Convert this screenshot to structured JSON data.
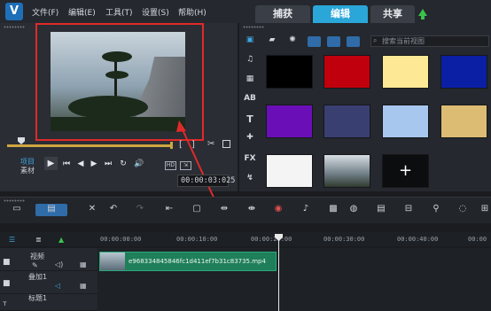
{
  "menu": {
    "logo": "V",
    "items": [
      "文件(F)",
      "编辑(E)",
      "工具(T)",
      "设置(S)",
      "帮助(H)"
    ]
  },
  "tabs": [
    {
      "label": "捕获",
      "active": false
    },
    {
      "label": "编辑",
      "active": true
    },
    {
      "label": "共享",
      "active": false
    }
  ],
  "player": {
    "mode_project": "项目",
    "mode_clip": "素材",
    "timecode": "00:00:03:025",
    "mark_in": "[",
    "mark_out": "]"
  },
  "library": {
    "search_placeholder": "搜索当前视图",
    "sidebar_labels": [
      "FX"
    ],
    "swatch_colors": [
      "#000000",
      "#c0000d",
      "#fde995",
      "#0b1fa5",
      "#6a0fb8",
      "#3a3f72",
      "#a8c7ef",
      "#dcbb73"
    ],
    "add_label": "+"
  },
  "timeline": {
    "ruler": [
      "00:00:00:00",
      "00:00:10:00",
      "00:00:20:00",
      "00:00:30:00",
      "00:00:40:00",
      "00:00"
    ],
    "tracks": [
      "视频",
      "叠加1",
      "标题1"
    ],
    "clip_name": "e968334845846fc1d411ef7b31c83735.mp4"
  },
  "colors": {
    "accent": "#2aa6d8",
    "highlight": "#e02a2a",
    "clip": "#1f7f5a"
  }
}
